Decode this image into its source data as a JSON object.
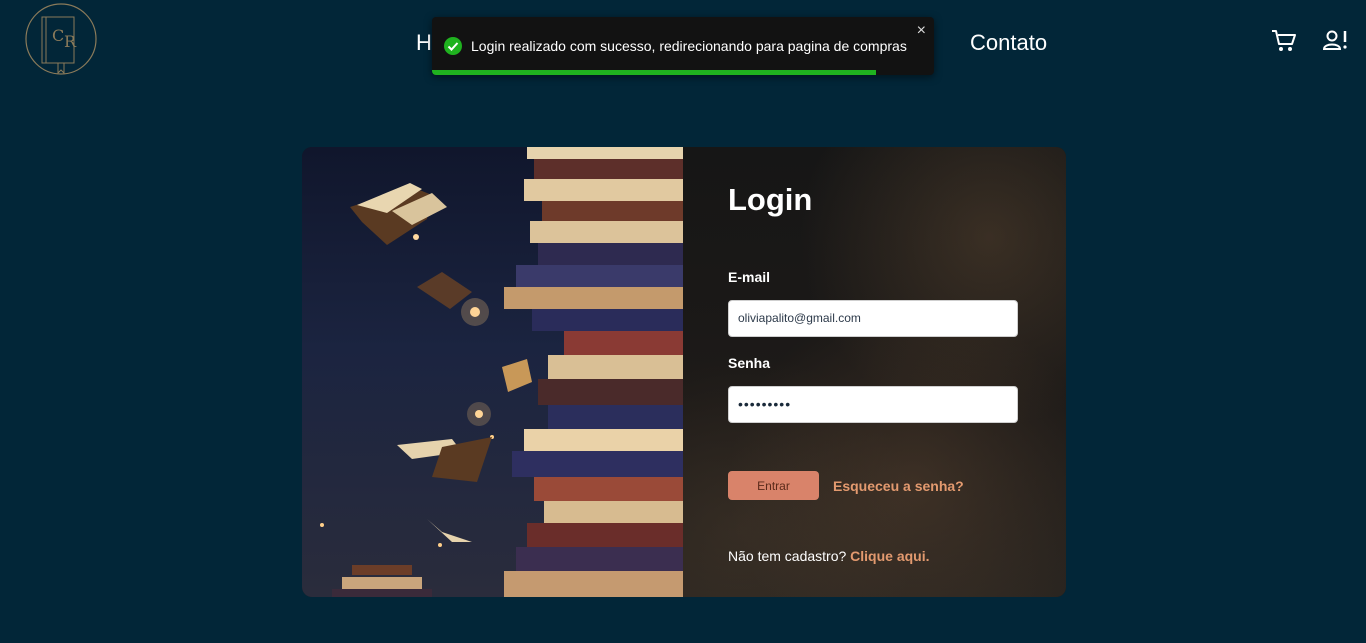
{
  "header": {
    "nav": {
      "home_partial": "H",
      "contato": "Contato"
    },
    "icons": {
      "logo": "book-logo-icon",
      "cart": "cart-icon",
      "user": "user-alert-icon"
    }
  },
  "toast": {
    "message": "Login realizado com sucesso, redirecionando para pagina de compras",
    "close_symbol": "×",
    "progress_fraction": 0.885,
    "status_color": "#1fb21f",
    "icon": "check-circle-icon"
  },
  "login": {
    "title": "Login",
    "email_label": "E-mail",
    "email_value": "oliviapalito@gmail.com",
    "senha_label": "Senha",
    "senha_value": "•••••••••",
    "submit_label": "Entrar",
    "forgot_label": "Esqueceu a senha?",
    "signup_prompt": "Não tem cadastro?",
    "signup_link": "Clique aqui."
  },
  "colors": {
    "background": "#022638",
    "accent": "#e39a6f",
    "button": "#d9836a"
  }
}
